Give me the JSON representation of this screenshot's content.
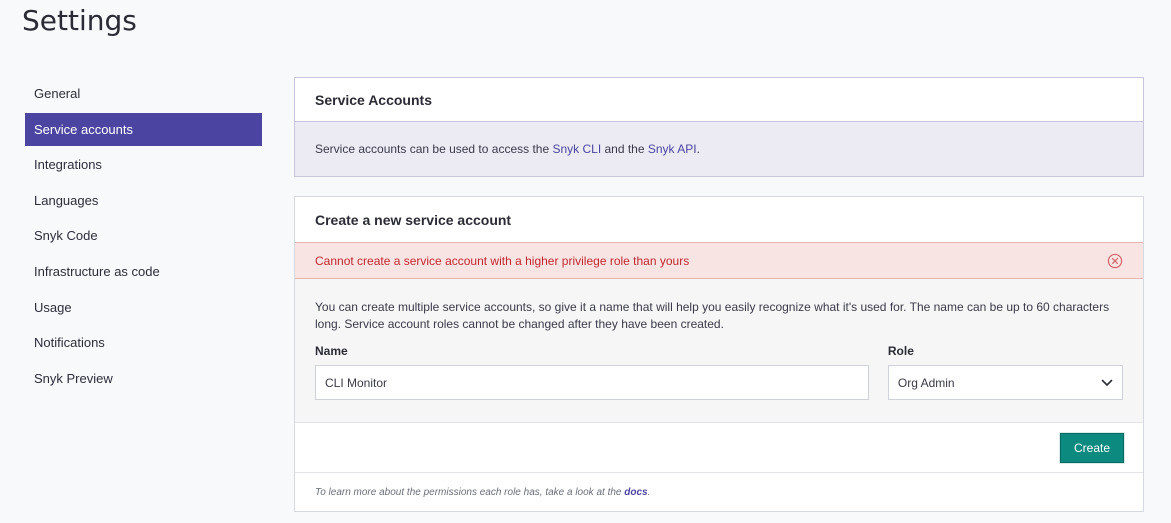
{
  "page": {
    "title": "Settings"
  },
  "sidebar": {
    "items": [
      {
        "label": "General"
      },
      {
        "label": "Service accounts",
        "active": true
      },
      {
        "label": "Integrations"
      },
      {
        "label": "Languages"
      },
      {
        "label": "Snyk Code"
      },
      {
        "label": "Infrastructure as code"
      },
      {
        "label": "Usage"
      },
      {
        "label": "Notifications"
      },
      {
        "label": "Snyk Preview"
      }
    ]
  },
  "service_accounts": {
    "title": "Service Accounts",
    "info_prefix": "Service accounts can be used to access the ",
    "cli_link": "Snyk CLI",
    "info_mid": " and the ",
    "api_link": "Snyk API",
    "info_suffix": "."
  },
  "create": {
    "title": "Create a new service account",
    "error": "Cannot create a service account with a higher privilege role than yours",
    "description": "You can create multiple service accounts, so give it a name that will help you easily recognize what it's used for. The name can be up to 60 characters long. Service account roles cannot be changed after they have been created.",
    "name_label": "Name",
    "name_value": "CLI Monitor",
    "role_label": "Role",
    "role_value": "Org Admin",
    "create_button": "Create",
    "footnote_prefix": "To learn more about the permissions each role has, take a look at the ",
    "footnote_link": "docs",
    "footnote_suffix": "."
  },
  "colors": {
    "accent": "#4b45a1",
    "create_button": "#0d8a80",
    "error_text": "#c0282e",
    "error_bg": "#f9e4e4",
    "info_bg": "#ecebf4"
  }
}
